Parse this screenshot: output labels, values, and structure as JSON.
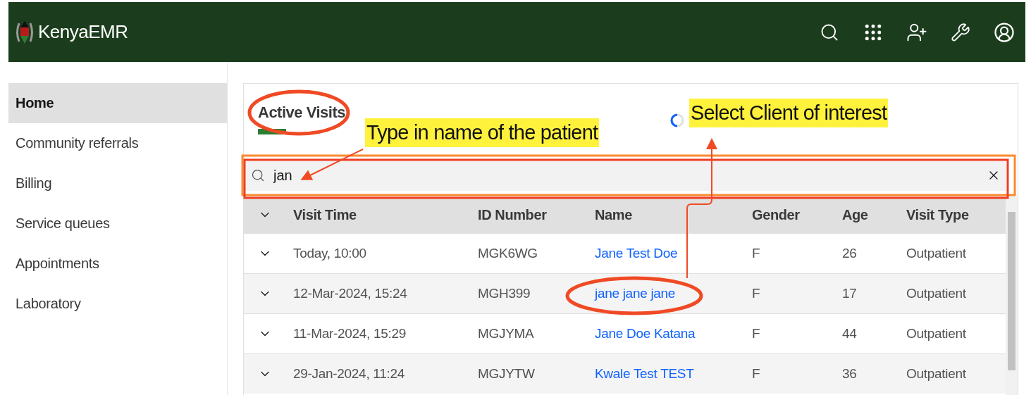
{
  "header": {
    "brand": "KenyaEMR"
  },
  "sidebar": {
    "items": [
      {
        "label": "Home",
        "selected": true
      },
      {
        "label": "Community referrals",
        "selected": false
      },
      {
        "label": "Billing",
        "selected": false
      },
      {
        "label": "Service queues",
        "selected": false
      },
      {
        "label": "Appointments",
        "selected": false
      },
      {
        "label": "Laboratory",
        "selected": false
      }
    ]
  },
  "panel": {
    "title": "Active Visits",
    "title_circled": true,
    "search": {
      "value": "jan"
    }
  },
  "table": {
    "columns": [
      "Visit Time",
      "ID Number",
      "Name",
      "Gender",
      "Age",
      "Visit Type"
    ],
    "rows": [
      {
        "visit_time": "Today, 10:00",
        "id_number": "MGK6WG",
        "name": "Jane Test Doe",
        "gender": "F",
        "age": "26",
        "visit_type": "Outpatient",
        "circled": false
      },
      {
        "visit_time": "12-Mar-2024, 15:24",
        "id_number": "MGH399",
        "name": "jane jane jane",
        "gender": "F",
        "age": "17",
        "visit_type": "Outpatient",
        "circled": true
      },
      {
        "visit_time": "11-Mar-2024, 15:29",
        "id_number": "MGJYMA",
        "name": "Jane Doe Katana",
        "gender": "F",
        "age": "44",
        "visit_type": "Outpatient",
        "circled": false
      },
      {
        "visit_time": "29-Jan-2024, 11:24",
        "id_number": "MGJYTW",
        "name": "Kwale Test TEST",
        "gender": "F",
        "age": "36",
        "visit_type": "Outpatient",
        "circled": false
      }
    ]
  },
  "annotations": [
    {
      "kind": "search",
      "text": "Type in name of the patient"
    },
    {
      "kind": "select",
      "text": "Select Client of interest"
    }
  ]
}
